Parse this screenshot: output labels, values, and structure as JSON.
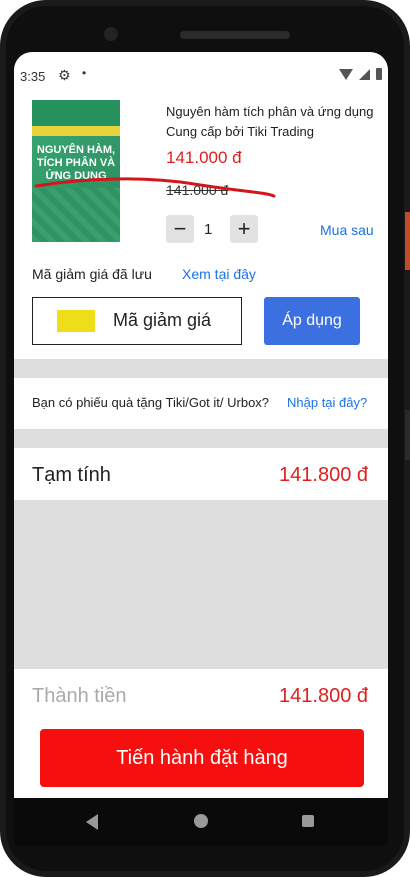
{
  "status": {
    "time": "3:35"
  },
  "product": {
    "cover_text": "NGUYÊN HÀM, TÍCH PHÂN VÀ ỨNG DỤNG",
    "title": "Nguyên hàm tích phân và ứng dụng",
    "seller": "Cung cấp bởi Tiki Trading",
    "price": "141.000 đ",
    "old_price": "141.000 đ",
    "quantity": "1",
    "minus": "−",
    "plus": "+",
    "buy_later": "Mua sau"
  },
  "coupon": {
    "saved_label": "Mã giảm giá đã lưu",
    "saved_link": "Xem tại đây",
    "label": "Mã giảm giá",
    "apply": "Áp dụng"
  },
  "gift": {
    "text": "Bạn có phiếu quà tặng Tiki/Got it/ Urbox?",
    "link": "Nhập tại đây?"
  },
  "summary": {
    "subtotal_label": "Tạm tính",
    "subtotal_value": "141.800 đ",
    "total_label": "Thành tiền",
    "total_value": "141.800 đ",
    "order_button": "Tiến hành đặt hàng"
  },
  "colors": {
    "accent_blue": "#3c6fe0",
    "price_red": "#e02020",
    "order_red": "#f50f0f"
  }
}
